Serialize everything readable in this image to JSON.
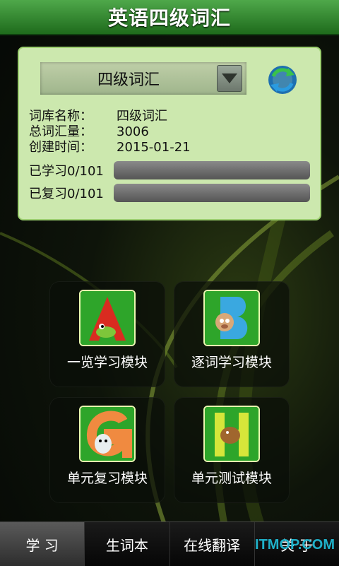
{
  "app": {
    "title": "英语四级词汇"
  },
  "selector": {
    "value": "四级词汇"
  },
  "info": {
    "rows": [
      {
        "label": "词库名称：",
        "value": "四级词汇"
      },
      {
        "label": "总词汇量：",
        "value": "3006"
      },
      {
        "label": "创建时间：",
        "value": "2015-01-21"
      }
    ],
    "learned": {
      "label": "已学习0/101",
      "progress": 0
    },
    "reviewed": {
      "label": "已复习0/101",
      "progress": 0
    }
  },
  "modules": [
    {
      "label": "一览学习模块",
      "letter": "A",
      "icon": "letter-a-crocodile-icon"
    },
    {
      "label": "逐词学习模块",
      "letter": "B",
      "icon": "letter-b-bear-icon"
    },
    {
      "label": "单元复习模块",
      "letter": "G",
      "icon": "letter-g-ghost-icon"
    },
    {
      "label": "单元测试模块",
      "letter": "H",
      "icon": "letter-h-horse-icon"
    }
  ],
  "tabs": [
    {
      "label": "学 习",
      "active": true
    },
    {
      "label": "生词本",
      "active": false
    },
    {
      "label": "在线翻译",
      "active": false
    },
    {
      "label": "关 于",
      "active": false
    }
  ],
  "watermark": "ITMOP.COM",
  "colors": {
    "accent": "#2e8b2a",
    "panel": "#cce8ae"
  }
}
